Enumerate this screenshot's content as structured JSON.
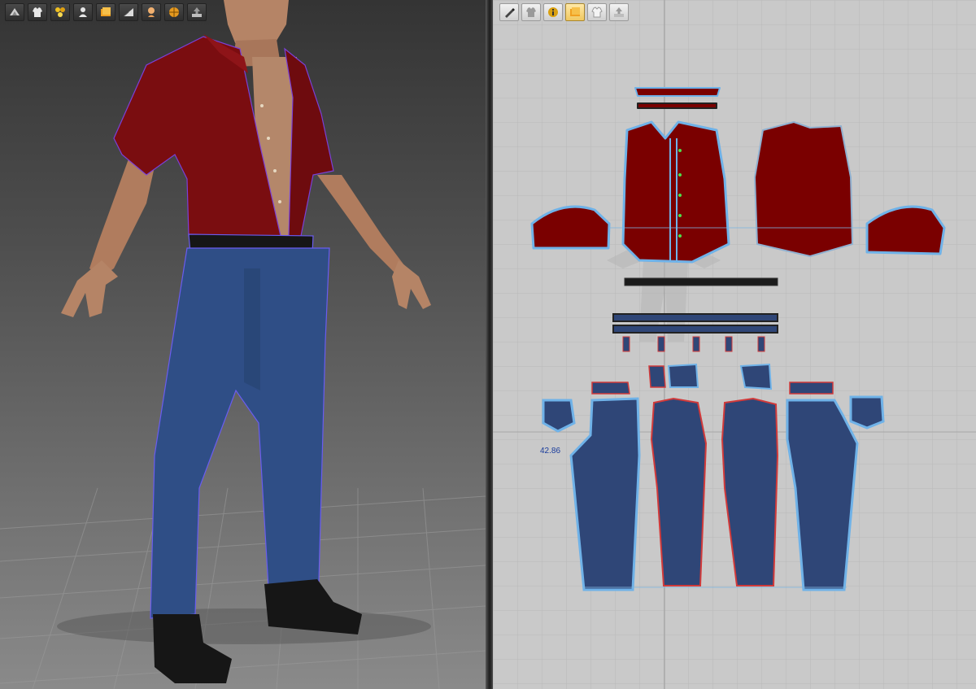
{
  "viewport3d": {
    "toolbar": [
      {
        "icon": "simulation-icon"
      },
      {
        "icon": "garment-icon"
      },
      {
        "icon": "particle-icon"
      },
      {
        "icon": "avatar-icon"
      },
      {
        "icon": "texture-icon"
      },
      {
        "icon": "mesh-icon"
      },
      {
        "icon": "skin-icon"
      },
      {
        "icon": "globe-icon"
      },
      {
        "icon": "export-icon"
      }
    ]
  },
  "viewport2d": {
    "toolbar": [
      {
        "icon": "pen-icon"
      },
      {
        "icon": "garment-front-icon"
      },
      {
        "icon": "info-icon"
      },
      {
        "icon": "texture-icon",
        "active": true
      },
      {
        "icon": "shirt-icon"
      },
      {
        "icon": "export-icon"
      }
    ],
    "measurement_label": "42.86"
  },
  "colors": {
    "shirt": "#7a0000",
    "denim": "#2f4677",
    "pattern_outline": "#6fb2e8",
    "seam_line": "#d23a3a",
    "grid_bg": "#c9c9c9"
  }
}
